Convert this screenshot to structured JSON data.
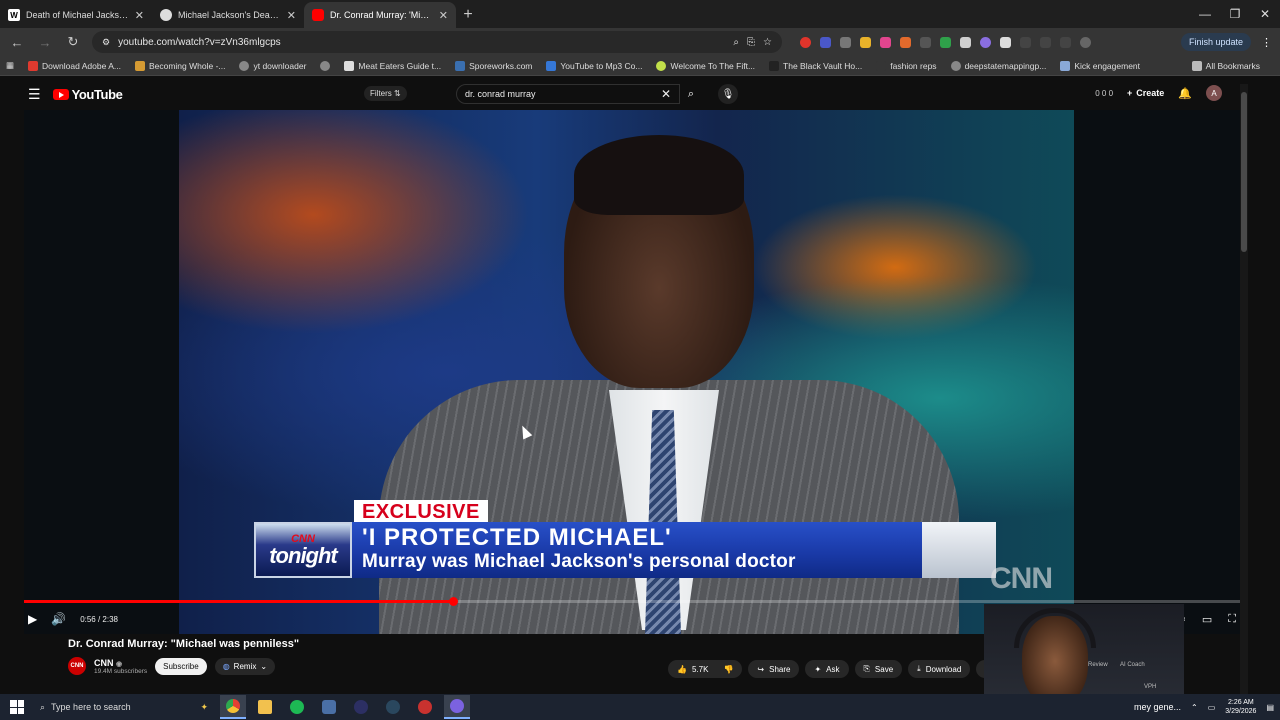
{
  "browser": {
    "tabs": [
      {
        "title": "Death of Michael Jackson - Wiki",
        "favicon": "W",
        "color": "#ffffff",
        "fg": "#000000"
      },
      {
        "title": "Michael Jackson's Death: Propo",
        "favicon": "",
        "color": "#e0e0e0",
        "fg": "#000000"
      },
      {
        "title": "Dr. Conrad Murray: 'Michael wa",
        "favicon": "",
        "color": "#ff0000",
        "fg": "#ffffff"
      }
    ],
    "new_tab_icon": "plus-icon",
    "url": "youtube.com/watch?v=zVn36mlgcps",
    "finish_update": "Finish update",
    "bookmarks": [
      {
        "label": "Download Adobe A...",
        "color": "#e03a2f"
      },
      {
        "label": "Becoming Whole -...",
        "color": "#d59b33"
      },
      {
        "label": "yt downloader",
        "color": "#888888"
      },
      {
        "label": "",
        "color": "#888888"
      },
      {
        "label": "Meat Eaters Guide t...",
        "color": "#dddddd"
      },
      {
        "label": "Sporeworks.com",
        "color": "#3a6fb0"
      },
      {
        "label": "YouTube to Mp3 Co...",
        "color": "#3577d6"
      },
      {
        "label": "Welcome To The Fift...",
        "color": "#c2e04a"
      },
      {
        "label": "The Black Vault Ho...",
        "color": "#222222"
      },
      {
        "label": "fashion reps",
        "color": "#353535"
      },
      {
        "label": "deepstatemappingp...",
        "color": "#888888"
      },
      {
        "label": "Kick engagement",
        "color": "#8aa9d8"
      }
    ],
    "all_bookmarks": "All Bookmarks"
  },
  "youtube": {
    "logo_text": "YouTube",
    "filters_label": "Filters",
    "search_value": "dr. conrad murray",
    "counters": "0  0  0",
    "create_label": "Create",
    "avatar_letter": "A"
  },
  "video": {
    "exclusive": "EXCLUSIVE",
    "show_line1": "CNN",
    "show_line2": "tonight",
    "headline": "'I PROTECTED MICHAEL'",
    "subheadline": "Murray was Michael Jackson's personal doctor",
    "watermark": "CNN",
    "time": "0:56 / 2:38",
    "progress_fraction": 0.353
  },
  "below": {
    "title": "Dr. Conrad Murray: \"Michael was penniless\"",
    "channel_logo": "CNN",
    "channel_name": "CNN",
    "subscribers": "19.4M subscribers",
    "subscribe": "Subscribe",
    "remix": "Remix",
    "likes": "5.7K",
    "share": "Share",
    "ask": "Ask",
    "save": "Save",
    "download": "Download"
  },
  "webcam": {
    "label_review": "Review",
    "label_coach": "AI Coach",
    "label_vph": "VPH"
  },
  "taskbar": {
    "search_placeholder": "Type here to search",
    "news": "mey gene...",
    "time": "2:26 AM",
    "date": "3/29/2026"
  }
}
